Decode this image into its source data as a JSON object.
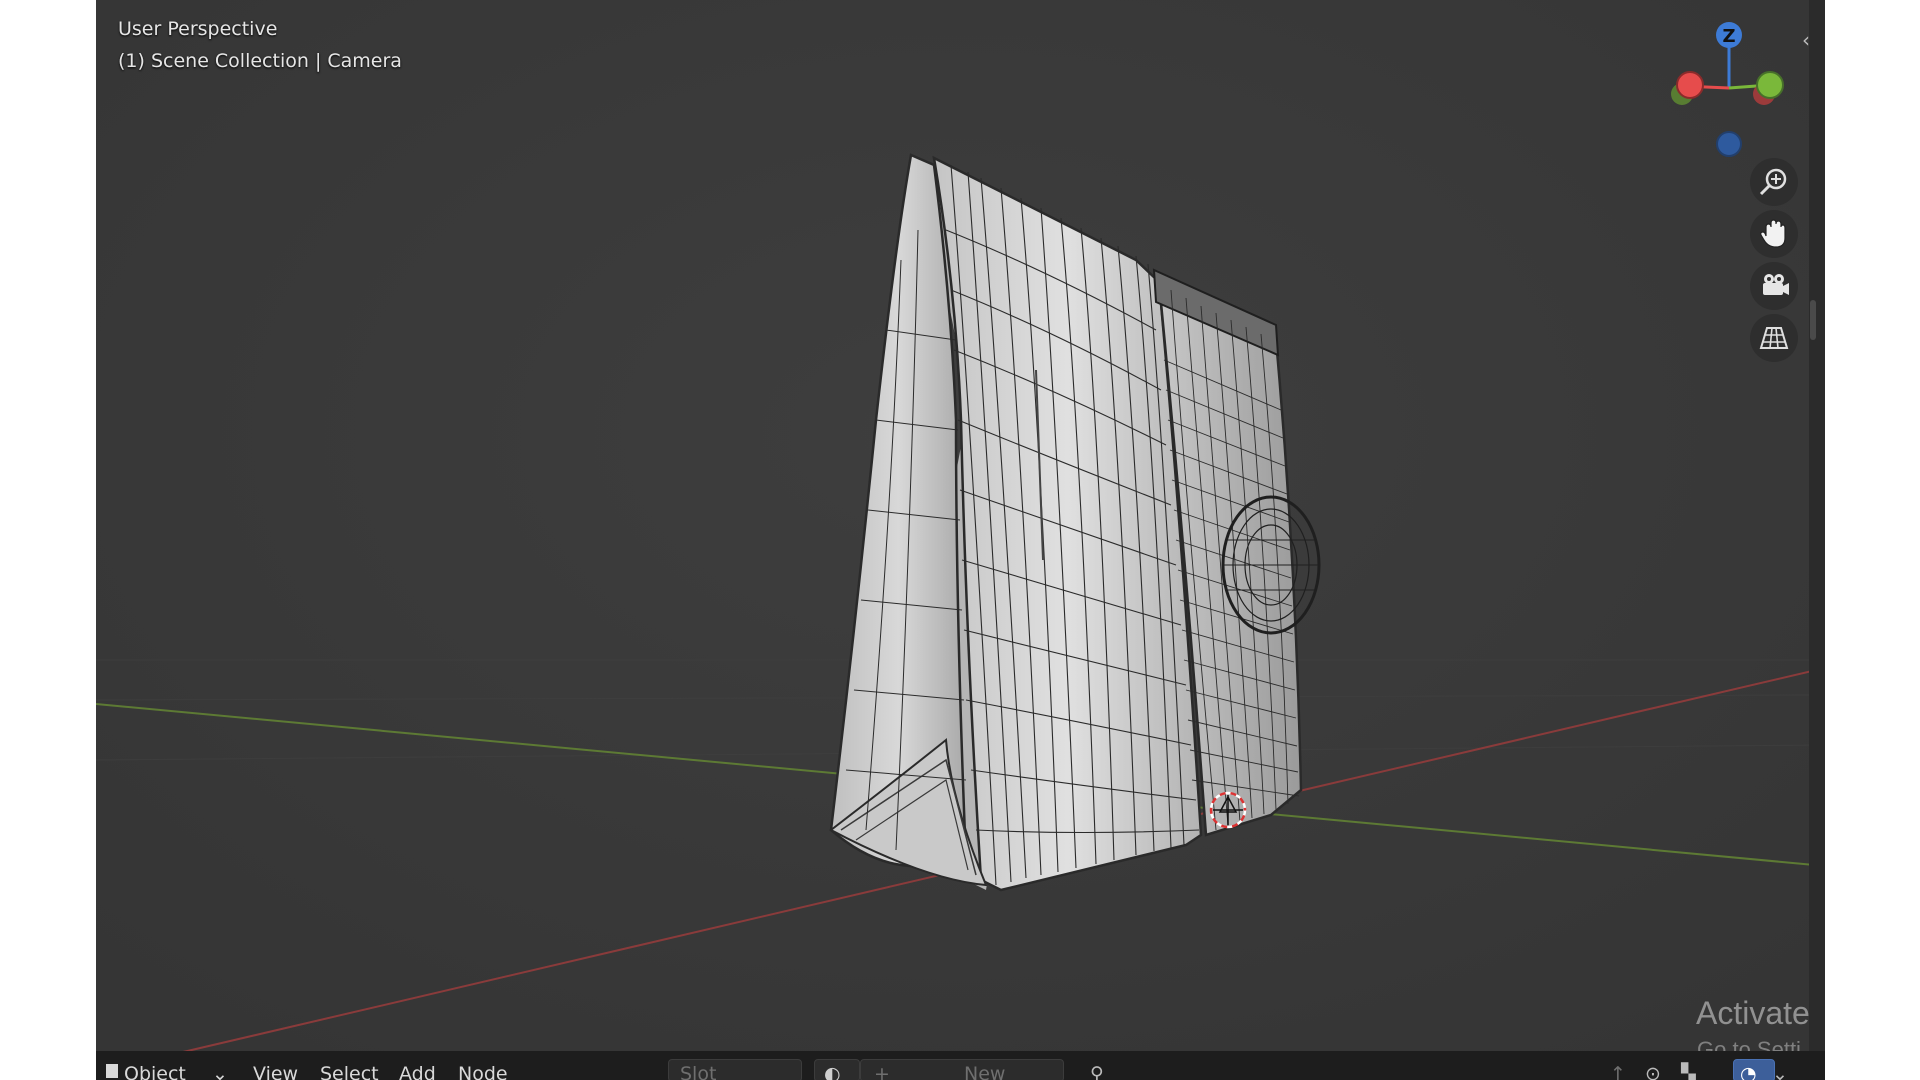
{
  "viewport": {
    "view_name": "User Perspective",
    "collection_info": "(1) Scene Collection | Camera"
  },
  "gizmo": {
    "z_label": "Z",
    "colors": {
      "x": "#e64c4c",
      "y": "#7ab83a",
      "z": "#3d7bd6"
    }
  },
  "nav": [
    {
      "name": "zoom-icon"
    },
    {
      "name": "hand-pan-icon"
    },
    {
      "name": "camera-view-icon"
    },
    {
      "name": "perspective-grid-icon"
    }
  ],
  "header_bottom": {
    "mode": "Object",
    "menus": [
      "View",
      "Select",
      "Add",
      "Node"
    ],
    "slot": "Slot",
    "new_label": "New"
  },
  "watermark": {
    "line1": "Activate",
    "line2": "Go to Setti"
  }
}
